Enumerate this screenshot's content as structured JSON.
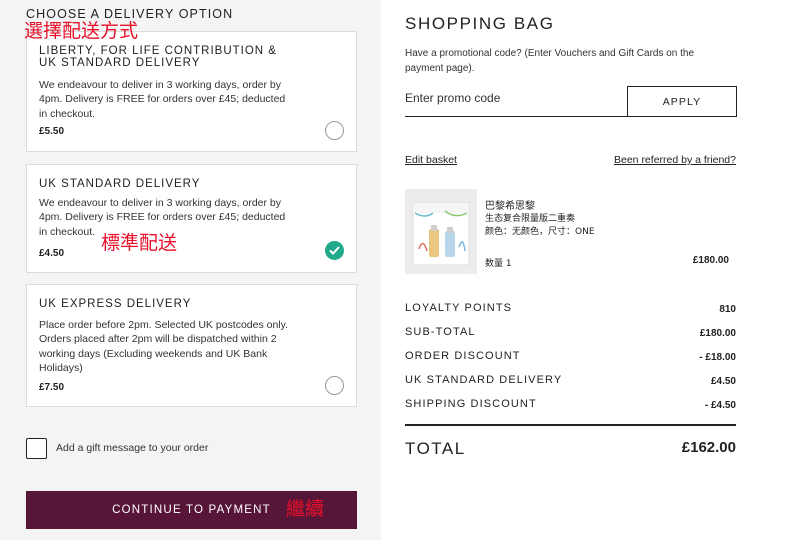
{
  "delivery": {
    "heading": "CHOOSE A DELIVERY OPTION",
    "options": [
      {
        "title": [
          "LIBERTY, FOR LIFE CONTRIBUTION &",
          "UK STANDARD DELIVERY"
        ],
        "description": "We endeavour to deliver in 3 working days, order by 4pm. Delivery is FREE for orders over £45; deducted in checkout.",
        "price": "£5.50",
        "selected": false
      },
      {
        "title": [
          "UK STANDARD DELIVERY"
        ],
        "description": "We endeavour to deliver in 3 working days, order by 4pm. Delivery is FREE for orders over £45; deducted in checkout.",
        "price": "£4.50",
        "selected": true
      },
      {
        "title": [
          "UK EXPRESS DELIVERY"
        ],
        "description": "Place order before 2pm. Selected UK postcodes only. Orders placed after 2pm will be dispatched within 2 working days (Excluding weekends and UK Bank Holidays)",
        "price": "£7.50",
        "selected": false
      }
    ],
    "gift_message_label": "Add a gift message to your order",
    "continue_label": "CONTINUE TO PAYMENT"
  },
  "annotations": {
    "choose_method": "選擇配送方式",
    "standard_delivery": "標準配送",
    "continue": "繼續"
  },
  "bag": {
    "title": "SHOPPING BAG",
    "promo_text": "Have a promotional code? (Enter Vouchers and Gift Cards on the payment page).",
    "promo_placeholder": "Enter promo code",
    "apply_label": "APPLY",
    "edit_basket": "Edit basket",
    "referred_link": "Been referred by a friend?",
    "product": {
      "name": "巴黎希思黎",
      "subtitle": "生态复合限量版二重奏",
      "variant": "颜色：无颜色，尺寸：ONE",
      "quantity": "数量 1",
      "price": "£180.00"
    },
    "summary": [
      {
        "label": "LOYALTY POINTS",
        "value": "810"
      },
      {
        "label": "SUB-TOTAL",
        "value": "£180.00"
      },
      {
        "label": "ORDER DISCOUNT",
        "value": "- £18.00"
      },
      {
        "label": "UK STANDARD DELIVERY",
        "value": "£4.50"
      },
      {
        "label": "SHIPPING DISCOUNT",
        "value": "- £4.50"
      }
    ],
    "total_label": "TOTAL",
    "total_value": "£162.00"
  },
  "colors": {
    "accent": "#571538",
    "selected": "#20a98a",
    "annotation": "#e8102a",
    "panel": "#f4f4f4"
  }
}
